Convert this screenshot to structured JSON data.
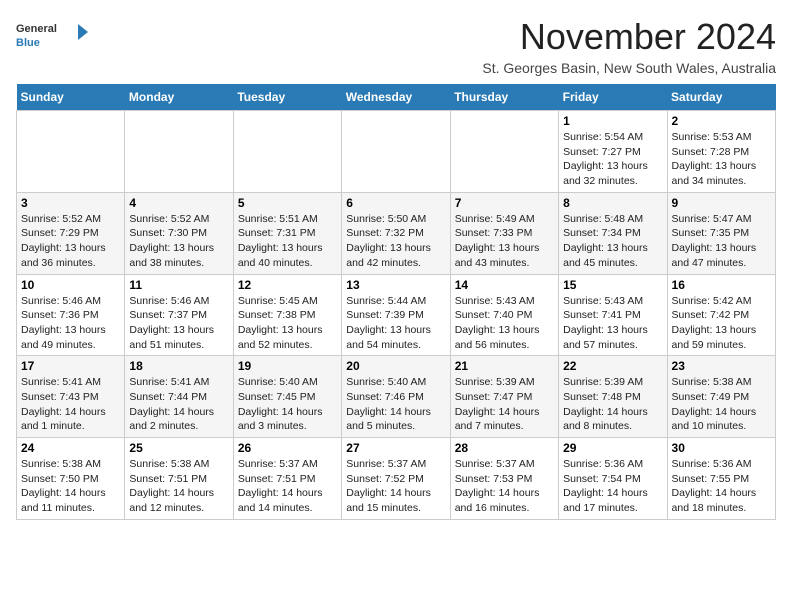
{
  "header": {
    "logo_general": "General",
    "logo_blue": "Blue",
    "month_title": "November 2024",
    "location": "St. Georges Basin, New South Wales, Australia"
  },
  "days_of_week": [
    "Sunday",
    "Monday",
    "Tuesday",
    "Wednesday",
    "Thursday",
    "Friday",
    "Saturday"
  ],
  "weeks": [
    [
      {
        "day": "",
        "sunrise": "",
        "sunset": "",
        "daylight": ""
      },
      {
        "day": "",
        "sunrise": "",
        "sunset": "",
        "daylight": ""
      },
      {
        "day": "",
        "sunrise": "",
        "sunset": "",
        "daylight": ""
      },
      {
        "day": "",
        "sunrise": "",
        "sunset": "",
        "daylight": ""
      },
      {
        "day": "",
        "sunrise": "",
        "sunset": "",
        "daylight": ""
      },
      {
        "day": "1",
        "sunrise": "Sunrise: 5:54 AM",
        "sunset": "Sunset: 7:27 PM",
        "daylight": "Daylight: 13 hours and 32 minutes."
      },
      {
        "day": "2",
        "sunrise": "Sunrise: 5:53 AM",
        "sunset": "Sunset: 7:28 PM",
        "daylight": "Daylight: 13 hours and 34 minutes."
      }
    ],
    [
      {
        "day": "3",
        "sunrise": "Sunrise: 5:52 AM",
        "sunset": "Sunset: 7:29 PM",
        "daylight": "Daylight: 13 hours and 36 minutes."
      },
      {
        "day": "4",
        "sunrise": "Sunrise: 5:52 AM",
        "sunset": "Sunset: 7:30 PM",
        "daylight": "Daylight: 13 hours and 38 minutes."
      },
      {
        "day": "5",
        "sunrise": "Sunrise: 5:51 AM",
        "sunset": "Sunset: 7:31 PM",
        "daylight": "Daylight: 13 hours and 40 minutes."
      },
      {
        "day": "6",
        "sunrise": "Sunrise: 5:50 AM",
        "sunset": "Sunset: 7:32 PM",
        "daylight": "Daylight: 13 hours and 42 minutes."
      },
      {
        "day": "7",
        "sunrise": "Sunrise: 5:49 AM",
        "sunset": "Sunset: 7:33 PM",
        "daylight": "Daylight: 13 hours and 43 minutes."
      },
      {
        "day": "8",
        "sunrise": "Sunrise: 5:48 AM",
        "sunset": "Sunset: 7:34 PM",
        "daylight": "Daylight: 13 hours and 45 minutes."
      },
      {
        "day": "9",
        "sunrise": "Sunrise: 5:47 AM",
        "sunset": "Sunset: 7:35 PM",
        "daylight": "Daylight: 13 hours and 47 minutes."
      }
    ],
    [
      {
        "day": "10",
        "sunrise": "Sunrise: 5:46 AM",
        "sunset": "Sunset: 7:36 PM",
        "daylight": "Daylight: 13 hours and 49 minutes."
      },
      {
        "day": "11",
        "sunrise": "Sunrise: 5:46 AM",
        "sunset": "Sunset: 7:37 PM",
        "daylight": "Daylight: 13 hours and 51 minutes."
      },
      {
        "day": "12",
        "sunrise": "Sunrise: 5:45 AM",
        "sunset": "Sunset: 7:38 PM",
        "daylight": "Daylight: 13 hours and 52 minutes."
      },
      {
        "day": "13",
        "sunrise": "Sunrise: 5:44 AM",
        "sunset": "Sunset: 7:39 PM",
        "daylight": "Daylight: 13 hours and 54 minutes."
      },
      {
        "day": "14",
        "sunrise": "Sunrise: 5:43 AM",
        "sunset": "Sunset: 7:40 PM",
        "daylight": "Daylight: 13 hours and 56 minutes."
      },
      {
        "day": "15",
        "sunrise": "Sunrise: 5:43 AM",
        "sunset": "Sunset: 7:41 PM",
        "daylight": "Daylight: 13 hours and 57 minutes."
      },
      {
        "day": "16",
        "sunrise": "Sunrise: 5:42 AM",
        "sunset": "Sunset: 7:42 PM",
        "daylight": "Daylight: 13 hours and 59 minutes."
      }
    ],
    [
      {
        "day": "17",
        "sunrise": "Sunrise: 5:41 AM",
        "sunset": "Sunset: 7:43 PM",
        "daylight": "Daylight: 14 hours and 1 minute."
      },
      {
        "day": "18",
        "sunrise": "Sunrise: 5:41 AM",
        "sunset": "Sunset: 7:44 PM",
        "daylight": "Daylight: 14 hours and 2 minutes."
      },
      {
        "day": "19",
        "sunrise": "Sunrise: 5:40 AM",
        "sunset": "Sunset: 7:45 PM",
        "daylight": "Daylight: 14 hours and 3 minutes."
      },
      {
        "day": "20",
        "sunrise": "Sunrise: 5:40 AM",
        "sunset": "Sunset: 7:46 PM",
        "daylight": "Daylight: 14 hours and 5 minutes."
      },
      {
        "day": "21",
        "sunrise": "Sunrise: 5:39 AM",
        "sunset": "Sunset: 7:47 PM",
        "daylight": "Daylight: 14 hours and 7 minutes."
      },
      {
        "day": "22",
        "sunrise": "Sunrise: 5:39 AM",
        "sunset": "Sunset: 7:48 PM",
        "daylight": "Daylight: 14 hours and 8 minutes."
      },
      {
        "day": "23",
        "sunrise": "Sunrise: 5:38 AM",
        "sunset": "Sunset: 7:49 PM",
        "daylight": "Daylight: 14 hours and 10 minutes."
      }
    ],
    [
      {
        "day": "24",
        "sunrise": "Sunrise: 5:38 AM",
        "sunset": "Sunset: 7:50 PM",
        "daylight": "Daylight: 14 hours and 11 minutes."
      },
      {
        "day": "25",
        "sunrise": "Sunrise: 5:38 AM",
        "sunset": "Sunset: 7:51 PM",
        "daylight": "Daylight: 14 hours and 12 minutes."
      },
      {
        "day": "26",
        "sunrise": "Sunrise: 5:37 AM",
        "sunset": "Sunset: 7:51 PM",
        "daylight": "Daylight: 14 hours and 14 minutes."
      },
      {
        "day": "27",
        "sunrise": "Sunrise: 5:37 AM",
        "sunset": "Sunset: 7:52 PM",
        "daylight": "Daylight: 14 hours and 15 minutes."
      },
      {
        "day": "28",
        "sunrise": "Sunrise: 5:37 AM",
        "sunset": "Sunset: 7:53 PM",
        "daylight": "Daylight: 14 hours and 16 minutes."
      },
      {
        "day": "29",
        "sunrise": "Sunrise: 5:36 AM",
        "sunset": "Sunset: 7:54 PM",
        "daylight": "Daylight: 14 hours and 17 minutes."
      },
      {
        "day": "30",
        "sunrise": "Sunrise: 5:36 AM",
        "sunset": "Sunset: 7:55 PM",
        "daylight": "Daylight: 14 hours and 18 minutes."
      }
    ]
  ]
}
